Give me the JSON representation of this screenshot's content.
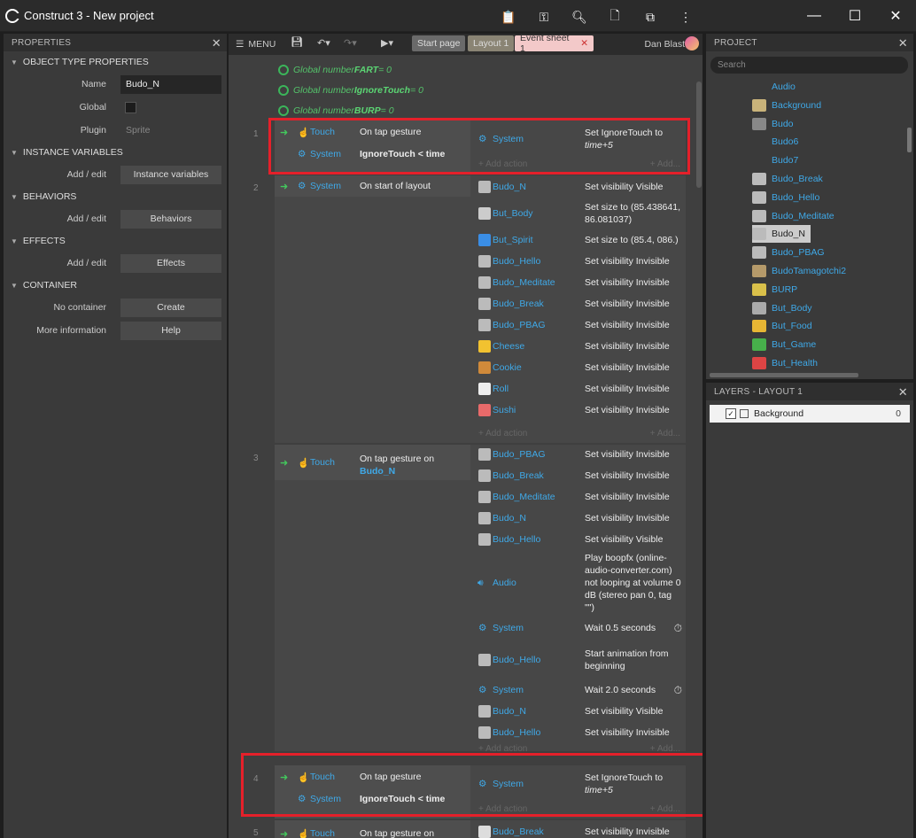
{
  "app": {
    "title": "Construct 3 - New project"
  },
  "props": {
    "header": "PROPERTIES",
    "sections": {
      "otp": "OBJECT TYPE PROPERTIES",
      "iv": "INSTANCE VARIABLES",
      "beh": "BEHAVIORS",
      "eff": "EFFECTS",
      "cont": "CONTAINER"
    },
    "name_label": "Name",
    "name_value": "Budo_N",
    "global_label": "Global",
    "plugin_label": "Plugin",
    "plugin_value": "Sprite",
    "add_edit": "Add / edit",
    "iv_button": "Instance variables",
    "beh_button": "Behaviors",
    "eff_button": "Effects",
    "no_container": "No container",
    "create_button": "Create",
    "more_info": "More information",
    "help_button": "Help"
  },
  "sheet": {
    "menu": "MENU",
    "tabs": [
      "Start page",
      "Layout 1",
      "Event sheet 1"
    ],
    "user": "Dan Blast",
    "globals": [
      {
        "pre": "Global number ",
        "name": "FART",
        "post": " = 0"
      },
      {
        "pre": "Global number ",
        "name": "IgnoreTouch",
        "post": " = 0"
      },
      {
        "pre": "Global number ",
        "name": "BURP",
        "post": " = 0"
      }
    ],
    "add_action": "+ Add action",
    "add_dots": "+ Add...",
    "ev1": {
      "num": "1",
      "c1o": "Touch",
      "c1t": "On tap gesture",
      "c2o": "System",
      "c2t": "IgnoreTouch < time",
      "ao": "System",
      "at1": "Set IgnoreTouch to",
      "at2": "time+5"
    },
    "ev2": {
      "num": "2",
      "co": "System",
      "ct": "On start of layout",
      "actions": [
        {
          "o": "Budo_N",
          "t": "Set visibility Visible"
        },
        {
          "o": "But_Body",
          "t": "Set size to (85.438641, 86.081037)"
        },
        {
          "o": "But_Spirit",
          "t": "Set size to (85.4, 086.)"
        },
        {
          "o": "Budo_Hello",
          "t": "Set visibility Invisible"
        },
        {
          "o": "Budo_Meditate",
          "t": "Set visibility Invisible"
        },
        {
          "o": "Budo_Break",
          "t": "Set visibility Invisible"
        },
        {
          "o": "Budo_PBAG",
          "t": "Set visibility Invisible"
        },
        {
          "o": "Cheese",
          "t": "Set visibility Invisible"
        },
        {
          "o": "Cookie",
          "t": "Set visibility Invisible"
        },
        {
          "o": "Roll",
          "t": "Set visibility Invisible"
        },
        {
          "o": "Sushi",
          "t": "Set visibility Invisible"
        }
      ]
    },
    "ev3": {
      "num": "3",
      "co": "Touch",
      "ct": "On tap gesture on",
      "ct2": "Budo_N",
      "actions": [
        {
          "o": "Budo_PBAG",
          "t": "Set visibility Invisible"
        },
        {
          "o": "Budo_Break",
          "t": "Set visibility Invisible"
        },
        {
          "o": "Budo_Meditate",
          "t": "Set visibility Invisible"
        },
        {
          "o": "Budo_N",
          "t": "Set visibility Invisible"
        },
        {
          "o": "Budo_Hello",
          "t": "Set visibility Visible"
        },
        {
          "o": "Audio",
          "t": "Play boopfx (online-audio-converter.com) not looping at volume 0 dB (stereo pan 0, tag \"\")"
        },
        {
          "o": "System",
          "t": "Wait 0.5 seconds"
        },
        {
          "o": "Budo_Hello",
          "t": "Start animation from beginning"
        },
        {
          "o": "System",
          "t": "Wait 2.0 seconds"
        },
        {
          "o": "Budo_N",
          "t": "Set visibility Visible"
        },
        {
          "o": "Budo_Hello",
          "t": "Set visibility Invisible"
        }
      ]
    },
    "ev4": {
      "num": "4",
      "c1o": "Touch",
      "c1t": "On tap gesture",
      "c2o": "System",
      "c2t": "IgnoreTouch < time",
      "ao": "System",
      "at1": "Set IgnoreTouch to",
      "at2": "time+5"
    },
    "ev5": {
      "num": "5",
      "co": "Touch",
      "ct": "On tap gesture on",
      "ao": "Budo_Break",
      "at": "Set visibility Invisible"
    }
  },
  "project": {
    "header": "PROJECT",
    "search_placeholder": "Search",
    "items": [
      "Audio",
      "Background",
      "Budo",
      "Budo6",
      "Budo7",
      "Budo_Break",
      "Budo_Hello",
      "Budo_Meditate",
      "Budo_N",
      "Budo_PBAG",
      "BudoTamagotchi2",
      "BURP",
      "But_Body",
      "But_Food",
      "But_Game",
      "But_Health"
    ]
  },
  "layers": {
    "header": "LAYERS - LAYOUT 1",
    "name": "Background",
    "num": "0"
  }
}
